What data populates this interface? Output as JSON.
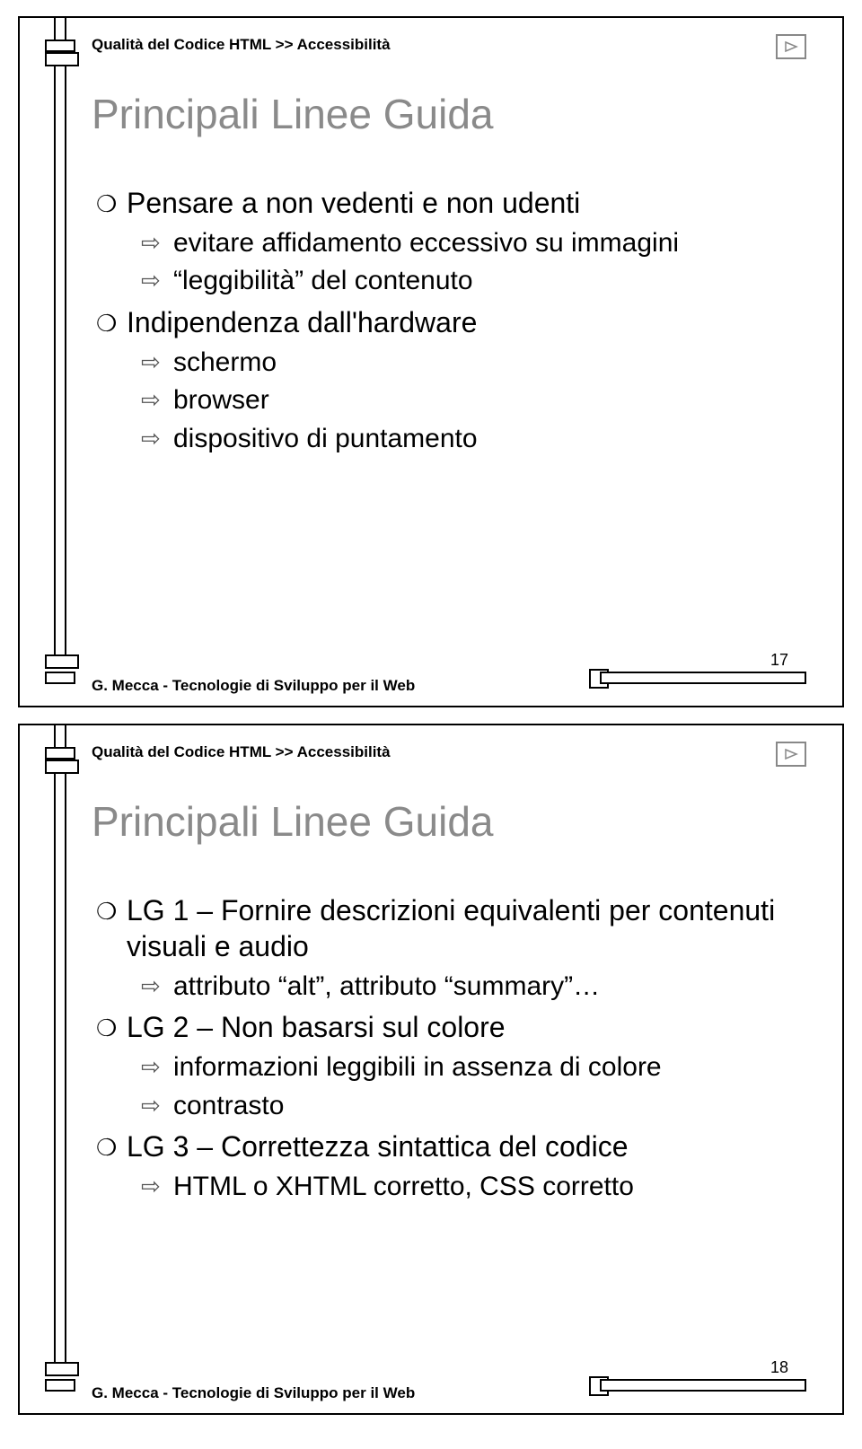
{
  "slides": [
    {
      "breadcrumb": "Qualità del Codice HTML >> Accessibilità",
      "title": "Principali Linee Guida",
      "items": [
        {
          "level": 1,
          "text": "Pensare a non vedenti e non udenti"
        },
        {
          "level": 2,
          "text": "evitare affidamento eccessivo su immagini"
        },
        {
          "level": 2,
          "text": "“leggibilità” del contenuto"
        },
        {
          "level": 1,
          "text": "Indipendenza dall'hardware"
        },
        {
          "level": 2,
          "text": "schermo"
        },
        {
          "level": 2,
          "text": "browser"
        },
        {
          "level": 2,
          "text": "dispositivo di puntamento"
        }
      ],
      "footer": "G. Mecca - Tecnologie di Sviluppo per il Web",
      "page": "17"
    },
    {
      "breadcrumb": "Qualità del Codice HTML >> Accessibilità",
      "title": "Principali Linee Guida",
      "items": [
        {
          "level": 1,
          "text": "LG 1 – Fornire descrizioni equivalenti per contenuti visuali e audio"
        },
        {
          "level": 2,
          "text": "attributo “alt”, attributo “summary”…"
        },
        {
          "level": 1,
          "text": "LG 2 – Non basarsi sul colore"
        },
        {
          "level": 2,
          "text": "informazioni leggibili in assenza di colore"
        },
        {
          "level": 2,
          "text": "contrasto"
        },
        {
          "level": 1,
          "text": "LG 3 – Correttezza sintattica del codice"
        },
        {
          "level": 2,
          "text": "HTML o XHTML corretto, CSS corretto"
        }
      ],
      "footer": "G. Mecca - Tecnologie di Sviluppo per il Web",
      "page": "18"
    }
  ]
}
